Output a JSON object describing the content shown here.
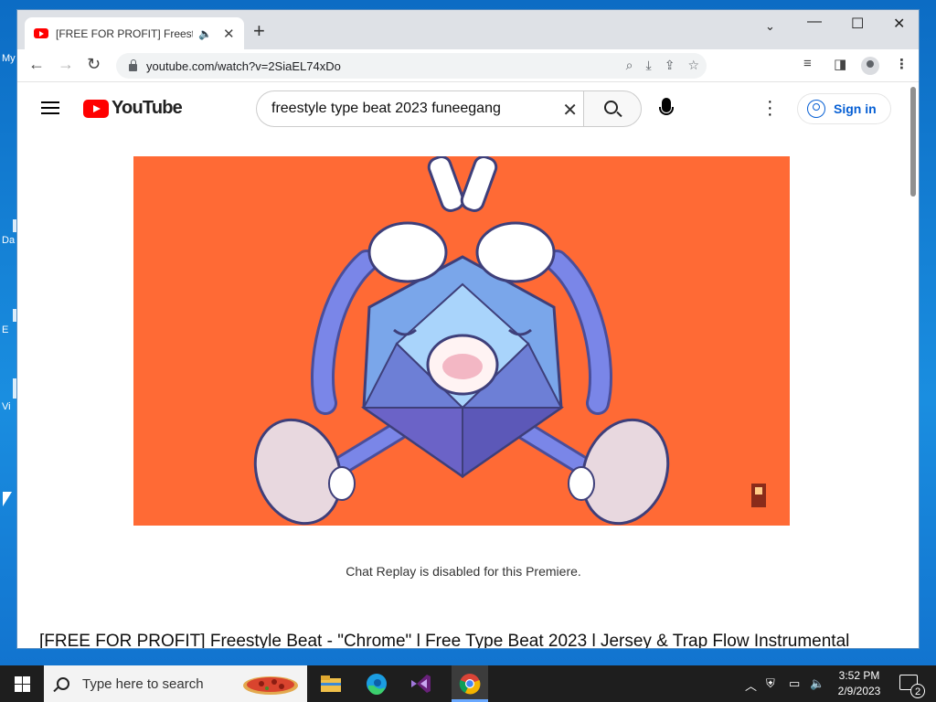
{
  "desktop": {
    "icons": [
      {
        "label": "My",
        "name": "desktop-icon-my"
      },
      {
        "label": "Da",
        "name": "desktop-icon-da"
      },
      {
        "label": "E",
        "name": "desktop-icon-e"
      },
      {
        "label": "Vi",
        "name": "desktop-icon-vi"
      }
    ]
  },
  "browser": {
    "tab": {
      "title": "[FREE FOR PROFIT] Freestyle",
      "favicon": "youtube-icon",
      "audio_icon": "speaker-icon"
    },
    "url": "youtube.com/watch?v=2SiaEL74xDo",
    "window_controls": {
      "minimize": "minimize-icon",
      "maximize": "maximize-icon",
      "close": "close-icon"
    }
  },
  "youtube": {
    "logo_text": "YouTube",
    "search": {
      "value": "freestyle type beat 2023 funeegang"
    },
    "signin_label": "Sign in",
    "video": {
      "background": "#ff6a35"
    },
    "chat_replay": "Chat Replay is disabled for this Premiere.",
    "title": "[FREE FOR PROFIT] Freestyle Beat - \"Chrome\" l Free Type Beat 2023 l Jersey & Trap Flow Instrumental"
  },
  "taskbar": {
    "search_placeholder": "Type here to search",
    "time": "3:52 PM",
    "date": "2/9/2023",
    "notification_count": "2",
    "apps": [
      "file-explorer-icon",
      "edge-icon",
      "visual-studio-icon",
      "chrome-icon"
    ]
  }
}
